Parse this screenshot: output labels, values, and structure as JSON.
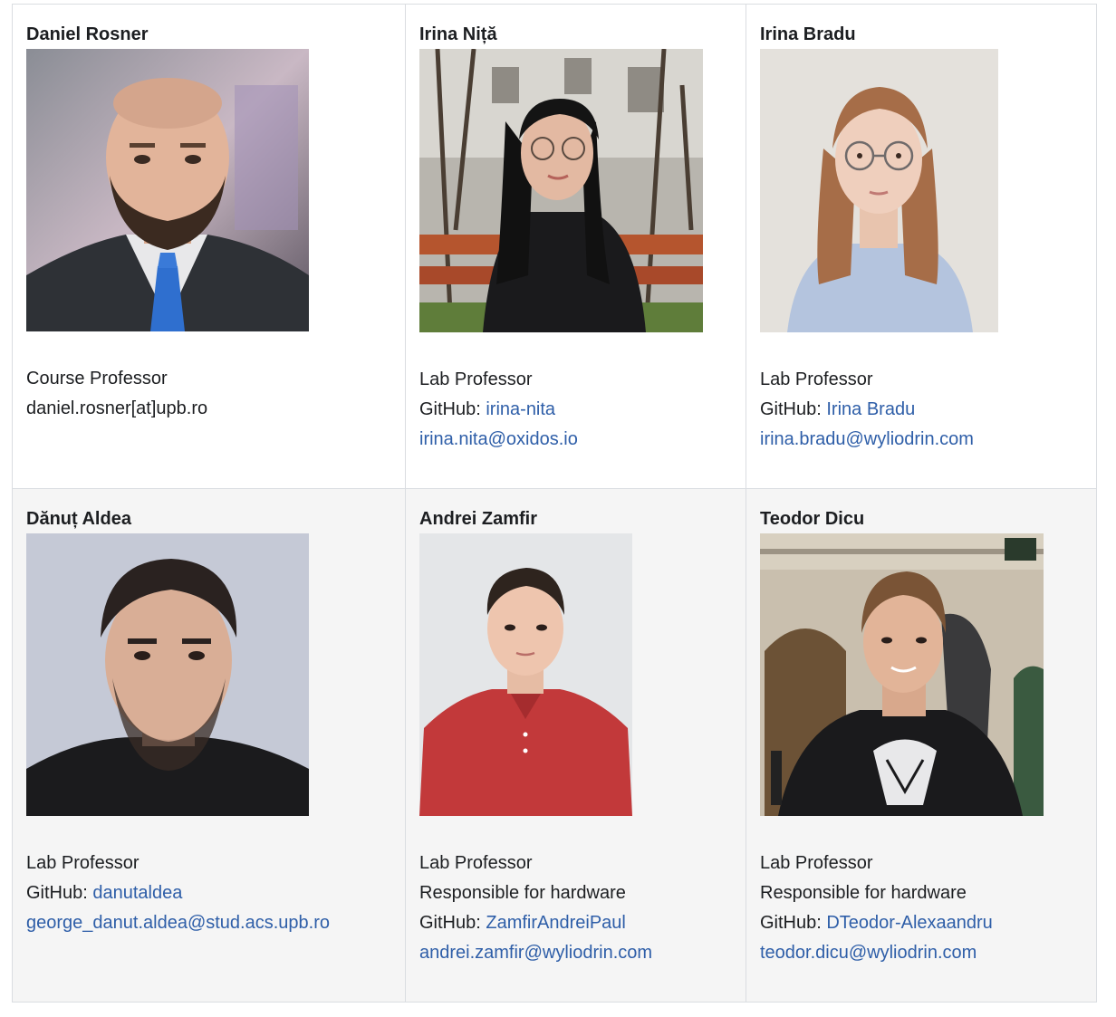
{
  "team": {
    "members": [
      {
        "name": "Daniel Rosner",
        "role": "Course Professor",
        "email_text": "daniel.rosner[at]upb.ro"
      },
      {
        "name": "Irina Niță",
        "role": "Lab Professor",
        "github_label": "GitHub: ",
        "github_handle": "irina-nita",
        "email": "irina.nita@oxidos.io"
      },
      {
        "name": "Irina Bradu",
        "role": "Lab Professor",
        "github_label": "GitHub: ",
        "github_handle": "Irina Bradu",
        "email": "irina.bradu@wyliodrin.com"
      },
      {
        "name": "Dănuț Aldea",
        "role": "Lab Professor",
        "github_label": "GitHub: ",
        "github_handle": "danutaldea",
        "email": "george_danut.aldea@stud.acs.upb.ro"
      },
      {
        "name": "Andrei Zamfir",
        "role": "Lab Professor",
        "extra": "Responsible for hardware",
        "github_label": "GitHub: ",
        "github_handle": "ZamfirAndreiPaul",
        "email": "andrei.zamfir@wyliodrin.com"
      },
      {
        "name": "Teodor Dicu",
        "role": "Lab Professor",
        "extra": "Responsible for hardware",
        "github_label": "GitHub: ",
        "github_handle": "DTeodor-Alexaandru",
        "email": "teodor.dicu@wyliodrin.com"
      }
    ]
  },
  "colors": {
    "link": "#2e5ea8",
    "text": "#1c1e21",
    "border": "#dadde1",
    "alt_row": "#f5f5f5"
  }
}
